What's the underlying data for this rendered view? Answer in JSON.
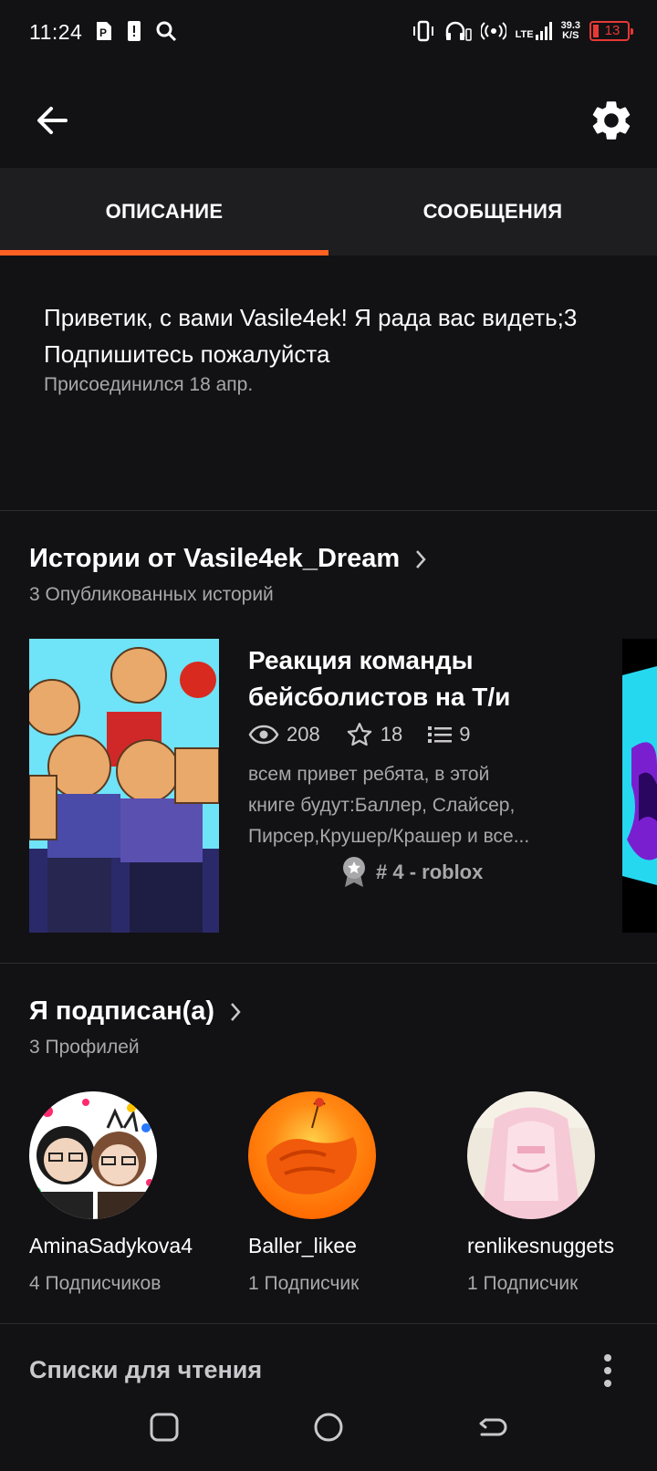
{
  "status_bar": {
    "time": "11:24",
    "net_speed_value": "39.3",
    "net_speed_unit": "K/S",
    "lte_label": "LTE",
    "battery": "13"
  },
  "tabs": [
    {
      "label": "ОПИСАНИЕ",
      "active": true
    },
    {
      "label": "СООБЩЕНИЯ",
      "active": false
    }
  ],
  "about": {
    "text": "Приветик, с вами Vasile4ek! Я рада вас видеть;3\nПодпишитесь пожалуйста",
    "joined": "Присоединился 18 апр."
  },
  "stories_section": {
    "title": "Истории от Vasile4ek_Dream",
    "subtitle": "3 Опубликованных историй",
    "story": {
      "title_line1": "Реакция команды",
      "title_line2": "бейсболистов на Т/и",
      "views": "208",
      "votes": "18",
      "parts": "9",
      "desc_line1": "всем привет ребята, в этой",
      "desc_line2": "книге будут:Баллер, Слайсер,",
      "desc_line3": "Пирсер,Крушер/Крашер и все...",
      "rank": "# 4 - roblox"
    }
  },
  "following_section": {
    "title": "Я подписан(а)",
    "subtitle": "3 Профилей",
    "profiles": [
      {
        "name": "AminaSadykova4",
        "followers": "4 Подписчиков"
      },
      {
        "name": "Baller_likee",
        "followers": "1 Подписчик"
      },
      {
        "name": "renlikesnuggets",
        "followers": "1 Подписчик"
      }
    ]
  },
  "reading_lists": {
    "title": "Списки для чтения"
  },
  "colors": {
    "accent": "#ff6122",
    "background": "#121113",
    "tab_bar": "#1e1d20",
    "battery_low": "#e53935"
  },
  "icons": [
    "back-arrow-icon",
    "gear-icon",
    "chevron-right-icon",
    "eye-icon",
    "star-icon",
    "list-icon",
    "ribbon-icon",
    "kebab-menu-icon",
    "recents-icon",
    "home-icon",
    "back-nav-icon"
  ]
}
